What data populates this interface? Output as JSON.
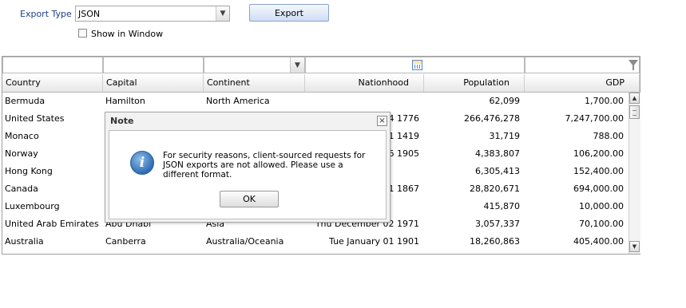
{
  "toolbar": {
    "export_type_label": "Export Type :",
    "export_type_value": "JSON",
    "export_button": "Export",
    "show_in_window_label": "Show in Window"
  },
  "grid": {
    "columns": [
      "Country",
      "Capital",
      "Continent",
      "Nationhood",
      "Population",
      "GDP"
    ],
    "rows": [
      [
        "Bermuda",
        "Hamilton",
        "North America",
        "",
        "62,099",
        "1,700.00"
      ],
      [
        "United States",
        "",
        "",
        "04 1776",
        "266,476,278",
        "7,247,700.00"
      ],
      [
        "Monaco",
        "",
        "",
        "01 1419",
        "31,719",
        "788.00"
      ],
      [
        "Norway",
        "",
        "",
        "26 1905",
        "4,383,807",
        "106,200.00"
      ],
      [
        "Hong Kong",
        "",
        "",
        "",
        "6,305,413",
        "152,400.00"
      ],
      [
        "Canada",
        "",
        "",
        "01 1867",
        "28,820,671",
        "694,000.00"
      ],
      [
        "Luxembourg",
        "",
        "",
        "",
        "415,870",
        "10,000.00"
      ],
      [
        "United Arab Emirates",
        "Abu Dhabi",
        "Asia",
        "Thu December 02 1971",
        "3,057,337",
        "70,100.00"
      ],
      [
        "Australia",
        "Canberra",
        "Australia/Oceania",
        "Tue January 01 1901",
        "18,260,863",
        "405,400.00"
      ]
    ]
  },
  "dialog": {
    "title": "Note",
    "message": "For security reasons, client-sourced requests for JSON exports are not allowed. Please use a different format.",
    "ok_button": "OK"
  }
}
